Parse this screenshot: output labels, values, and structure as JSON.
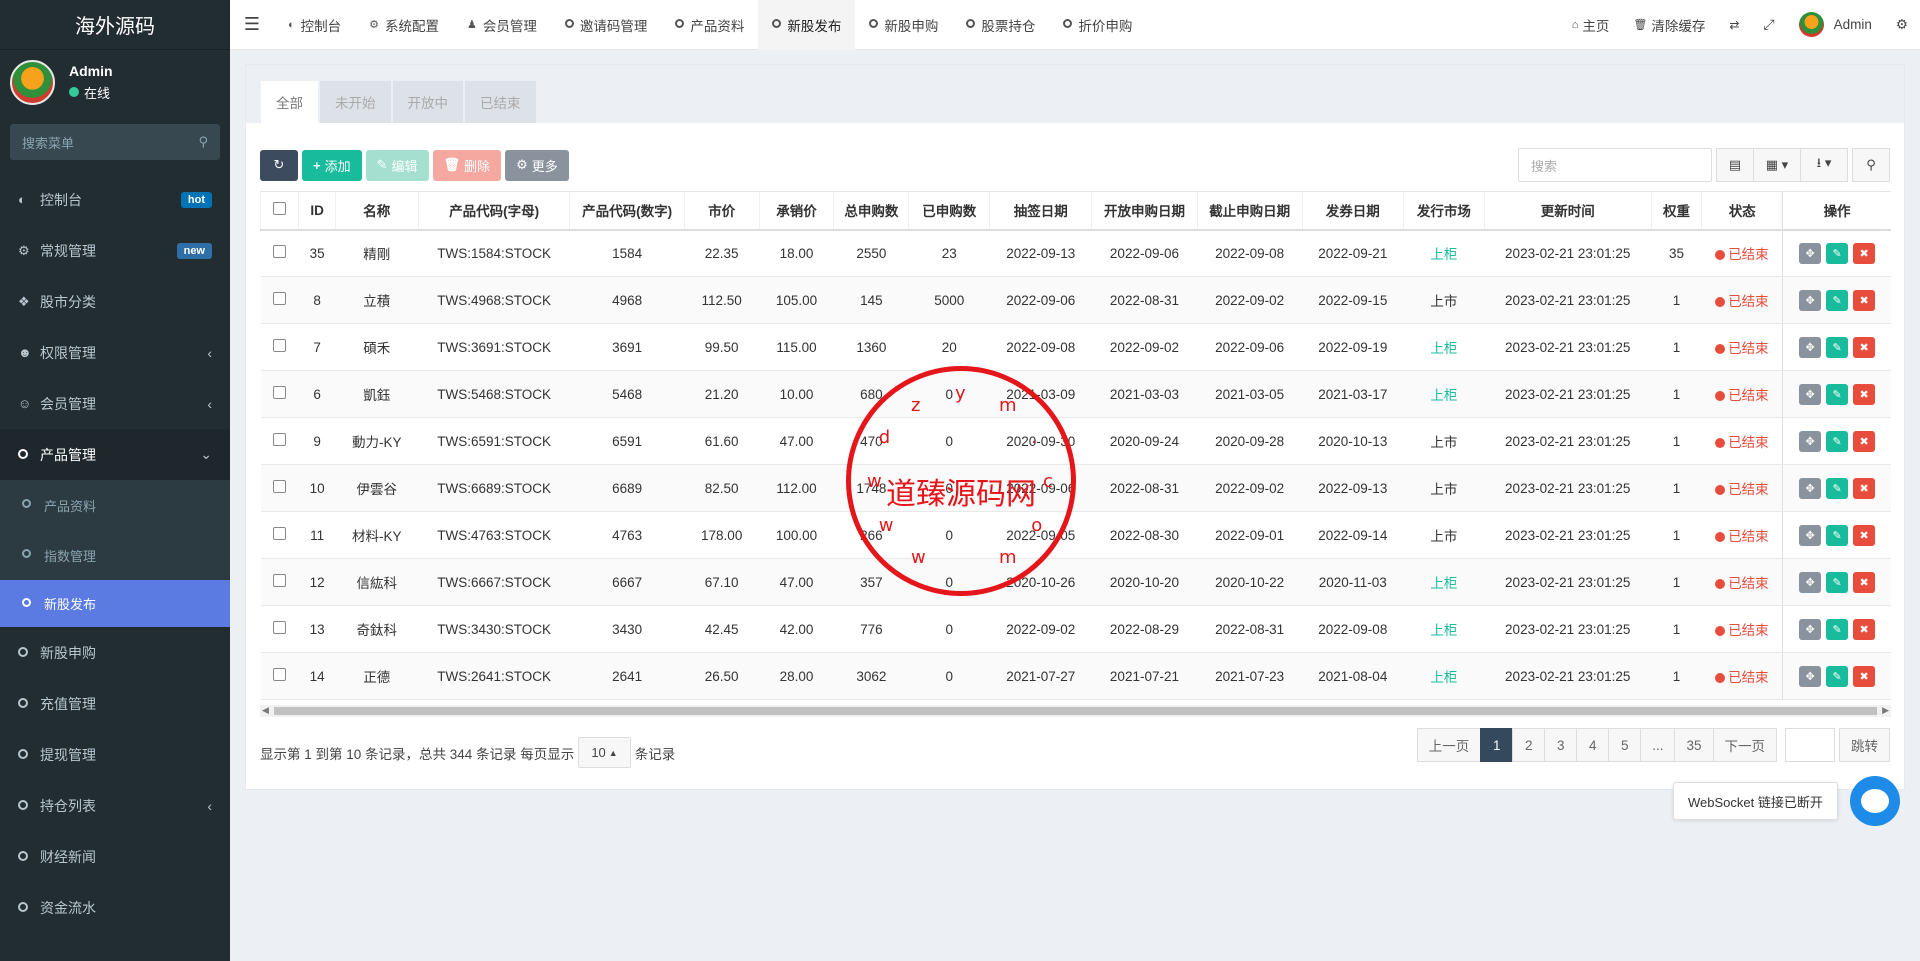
{
  "app": {
    "logo": "海外源码"
  },
  "user": {
    "name": "Admin",
    "status": "在线"
  },
  "sidebar": {
    "search_placeholder": "搜索菜单",
    "items": [
      {
        "label": "控制台",
        "icon": "dashboard-icon",
        "badge": "hot"
      },
      {
        "label": "常规管理",
        "icon": "cogs-icon",
        "badge": "new"
      },
      {
        "label": "股市分类",
        "icon": "leaf-icon"
      },
      {
        "label": "权限管理",
        "icon": "users-icon"
      },
      {
        "label": "会员管理",
        "icon": "user-circle-icon"
      },
      {
        "label": "产品管理",
        "icon": "circle-icon"
      },
      {
        "label": "产品资料",
        "icon": "circle-icon"
      },
      {
        "label": "指数管理",
        "icon": "circle-icon"
      },
      {
        "label": "新股发布",
        "icon": "circle-icon"
      },
      {
        "label": "新股申购",
        "icon": "circle-icon"
      },
      {
        "label": "充值管理",
        "icon": "circle-icon"
      },
      {
        "label": "提现管理",
        "icon": "circle-icon"
      },
      {
        "label": "持仓列表",
        "icon": "circle-icon"
      },
      {
        "label": "财经新闻",
        "icon": "circle-icon"
      },
      {
        "label": "资金流水",
        "icon": "circle-icon"
      }
    ]
  },
  "topbar": {
    "tabs": [
      {
        "label": "控制台",
        "icon": "dashboard-icon"
      },
      {
        "label": "系统配置",
        "icon": "gear-icon"
      },
      {
        "label": "会员管理",
        "icon": "user-icon"
      },
      {
        "label": "邀请码管理",
        "icon": "circle-icon"
      },
      {
        "label": "产品资料",
        "icon": "circle-icon"
      },
      {
        "label": "新股发布",
        "icon": "circle-icon"
      },
      {
        "label": "新股申购",
        "icon": "circle-icon"
      },
      {
        "label": "股票持仓",
        "icon": "circle-icon"
      },
      {
        "label": "折价申购",
        "icon": "circle-icon"
      }
    ],
    "home": "主页",
    "clear_cache": "清除缓存",
    "admin": "Admin"
  },
  "filter_tabs": [
    "全部",
    "未开始",
    "开放中",
    "已结束"
  ],
  "toolbar": {
    "add": "添加",
    "edit": "编辑",
    "delete": "删除",
    "more": "更多",
    "search_placeholder": "搜索"
  },
  "table": {
    "headers": [
      "ID",
      "名称",
      "产品代码(字母)",
      "产品代码(数字)",
      "市价",
      "承销价",
      "总申购数",
      "已申购数",
      "抽签日期",
      "开放申购日期",
      "截止申购日期",
      "发券日期",
      "发行市场",
      "更新时间",
      "权重",
      "状态",
      "操作"
    ],
    "rows": [
      [
        "35",
        "精剛",
        "TWS:1584:STOCK",
        "1584",
        "22.35",
        "18.00",
        "2550",
        "23",
        "2022-09-13",
        "2022-09-06",
        "2022-09-08",
        "2022-09-21",
        "上柜",
        "2023-02-21 23:01:25",
        "35",
        "已结束"
      ],
      [
        "8",
        "立積",
        "TWS:4968:STOCK",
        "4968",
        "112.50",
        "105.00",
        "145",
        "5000",
        "2022-09-06",
        "2022-08-31",
        "2022-09-02",
        "2022-09-15",
        "上市",
        "2023-02-21 23:01:25",
        "1",
        "已结束"
      ],
      [
        "7",
        "碩禾",
        "TWS:3691:STOCK",
        "3691",
        "99.50",
        "115.00",
        "1360",
        "20",
        "2022-09-08",
        "2022-09-02",
        "2022-09-06",
        "2022-09-19",
        "上柜",
        "2023-02-21 23:01:25",
        "1",
        "已结束"
      ],
      [
        "6",
        "凱鈺",
        "TWS:5468:STOCK",
        "5468",
        "21.20",
        "10.00",
        "680",
        "0",
        "2021-03-09",
        "2021-03-03",
        "2021-03-05",
        "2021-03-17",
        "上柜",
        "2023-02-21 23:01:25",
        "1",
        "已结束"
      ],
      [
        "9",
        "動力-KY",
        "TWS:6591:STOCK",
        "6591",
        "61.60",
        "47.00",
        "470",
        "0",
        "2020-09-30",
        "2020-09-24",
        "2020-09-28",
        "2020-10-13",
        "上市",
        "2023-02-21 23:01:25",
        "1",
        "已结束"
      ],
      [
        "10",
        "伊雲谷",
        "TWS:6689:STOCK",
        "6689",
        "82.50",
        "112.00",
        "1748",
        "0",
        "2022-09-06",
        "2022-08-31",
        "2022-09-02",
        "2022-09-13",
        "上市",
        "2023-02-21 23:01:25",
        "1",
        "已结束"
      ],
      [
        "11",
        "材料-KY",
        "TWS:4763:STOCK",
        "4763",
        "178.00",
        "100.00",
        "266",
        "0",
        "2022-09-05",
        "2022-08-30",
        "2022-09-01",
        "2022-09-14",
        "上市",
        "2023-02-21 23:01:25",
        "1",
        "已结束"
      ],
      [
        "12",
        "信紘科",
        "TWS:6667:STOCK",
        "6667",
        "67.10",
        "47.00",
        "357",
        "0",
        "2020-10-26",
        "2020-10-20",
        "2020-10-22",
        "2020-11-03",
        "上柜",
        "2023-02-21 23:01:25",
        "1",
        "已结束"
      ],
      [
        "13",
        "奇鈦科",
        "TWS:3430:STOCK",
        "3430",
        "42.45",
        "42.00",
        "776",
        "0",
        "2022-09-02",
        "2022-08-29",
        "2022-08-31",
        "2022-09-08",
        "上柜",
        "2023-02-21 23:01:25",
        "1",
        "已结束"
      ],
      [
        "14",
        "正德",
        "TWS:2641:STOCK",
        "2641",
        "26.50",
        "28.00",
        "3062",
        "0",
        "2021-07-27",
        "2021-07-21",
        "2021-07-23",
        "2021-08-04",
        "上柜",
        "2023-02-21 23:01:25",
        "1",
        "已结束"
      ]
    ]
  },
  "pagination": {
    "info_prefix": "显示第 1 到第 10 条记录，总共 344 条记录 每页显示",
    "page_size": "10",
    "info_suffix": "条记录",
    "prev": "上一页",
    "pages": [
      "1",
      "2",
      "3",
      "4",
      "5",
      "...",
      "35"
    ],
    "next": "下一页",
    "jump": "跳转"
  },
  "stamp": {
    "text": "道臻源码网",
    "letters": "wwwdzym.com"
  },
  "websocket": {
    "tip": "WebSocket 链接已断开"
  },
  "colors": {
    "sidebar_bg": "#222d32",
    "active_menu": "#5b7be3",
    "success": "#18bc9c",
    "danger": "#e74c3c"
  }
}
